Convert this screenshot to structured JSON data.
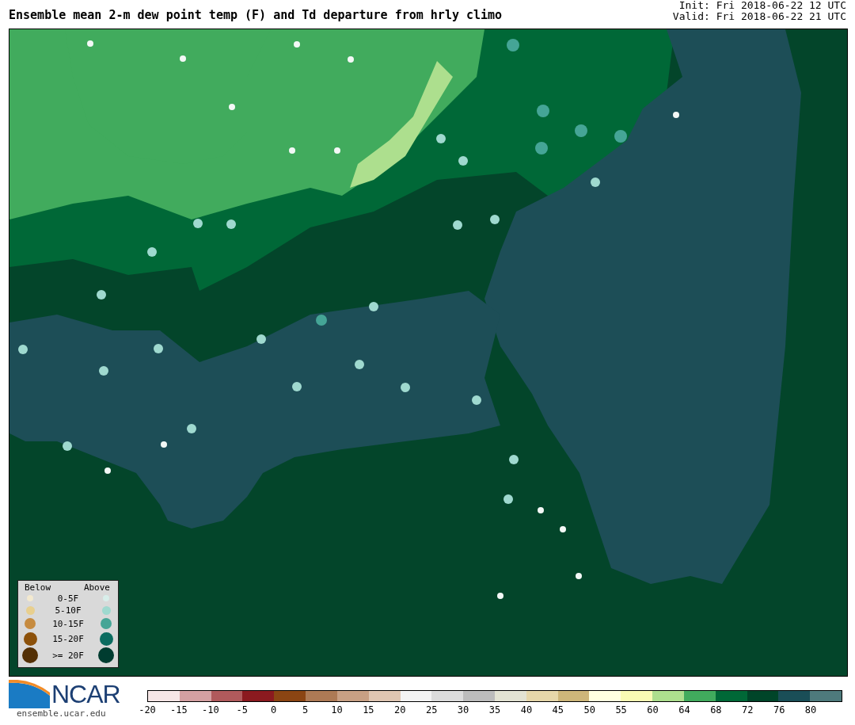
{
  "title": "Ensemble mean 2-m dew point temp (F) and Td departure from hrly climo",
  "init": "Init: Fri 2018-06-22 12 UTC",
  "valid": "Valid: Fri 2018-06-22 21 UTC",
  "legend": {
    "below_heading": "Below",
    "above_heading": "Above",
    "rows": [
      {
        "label": "0-5F",
        "below": {
          "color": "#f3e9cf"
        },
        "above": {
          "color": "#d8eeea"
        }
      },
      {
        "label": "5-10F",
        "below": {
          "color": "#e8cf8e"
        },
        "above": {
          "color": "#9fd9cf"
        }
      },
      {
        "label": "10-15F",
        "below": {
          "color": "#c68b40"
        },
        "above": {
          "color": "#45a596"
        }
      },
      {
        "label": "15-20F",
        "below": {
          "color": "#8c510a"
        },
        "above": {
          "color": "#0c6c60"
        }
      },
      {
        "label": ">= 20F",
        "below": {
          "color": "#543005"
        },
        "above": {
          "color": "#003c30"
        }
      }
    ]
  },
  "logo": {
    "text": "NCAR",
    "url": "ensemble.ucar.edu"
  },
  "colorbar": {
    "segments": [
      {
        "color": "#f6e6e6"
      },
      {
        "color": "#d4a0a2"
      },
      {
        "color": "#b05a5c"
      },
      {
        "color": "#8b1a1f"
      },
      {
        "color": "#8b4513"
      },
      {
        "color": "#ad7a55"
      },
      {
        "color": "#c8a084"
      },
      {
        "color": "#dfc6b2"
      },
      {
        "color": "#f3f3f3"
      },
      {
        "color": "#dcdcdc"
      },
      {
        "color": "#bcbcbc"
      },
      {
        "color": "#e3e3d3"
      },
      {
        "color": "#e6d7aa"
      },
      {
        "color": "#cdb67a"
      },
      {
        "color": "#ffffe0"
      },
      {
        "color": "#f9fbb4"
      },
      {
        "color": "#addf8e"
      },
      {
        "color": "#41ab5d"
      },
      {
        "color": "#006837"
      },
      {
        "color": "#004529"
      },
      {
        "color": "#1a4e57"
      },
      {
        "color": "#4e7a7c"
      }
    ],
    "ticks": [
      "-20",
      "-15",
      "-10",
      "-5",
      "0",
      "5",
      "10",
      "15",
      "20",
      "25",
      "30",
      "35",
      "40",
      "45",
      "50",
      "55",
      "60",
      "64",
      "68",
      "72",
      "76",
      "80"
    ]
  }
}
